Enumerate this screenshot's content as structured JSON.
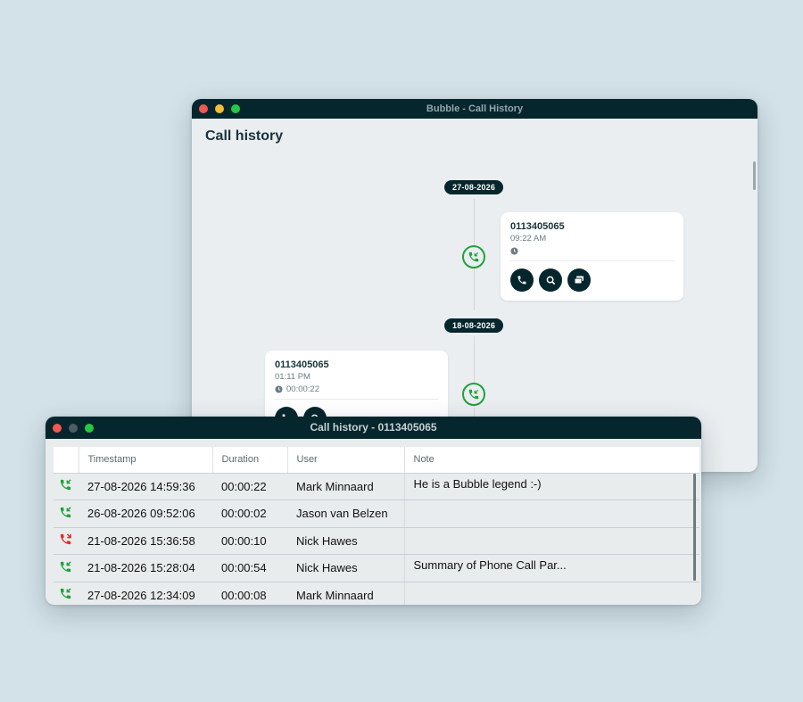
{
  "back_window": {
    "title": "Bubble - Call History",
    "page_title": "Call history",
    "entries": [
      {
        "date": "27-08-2026",
        "number": "0113405065",
        "time": "09:22 AM",
        "duration": "",
        "actions": [
          "phone-icon",
          "search-icon",
          "message-icon"
        ],
        "call_type_icon": "incoming-call-icon"
      },
      {
        "date": "18-08-2026",
        "number": "0113405065",
        "time": "01:11 PM",
        "duration": "00:00:22",
        "actions": [
          "phone-icon",
          "search-icon"
        ],
        "call_type_icon": "incoming-call-icon"
      }
    ]
  },
  "front_window": {
    "title": "Call history - 0113405065",
    "columns": [
      "Timestamp",
      "Duration",
      "User",
      "Note"
    ],
    "rows": [
      {
        "status": "incoming",
        "timestamp": "27-08-2026 14:59:36",
        "duration": "00:00:22",
        "user": "Mark Minnaard",
        "note": "He is a Bubble legend :-)"
      },
      {
        "status": "incoming",
        "timestamp": "26-08-2026 09:52:06",
        "duration": "00:00:02",
        "user": "Jason van Belzen",
        "note": ""
      },
      {
        "status": "missed",
        "timestamp": "21-08-2026 15:36:58",
        "duration": "00:00:10",
        "user": "Nick Hawes",
        "note": ""
      },
      {
        "status": "incoming",
        "timestamp": "21-08-2026 15:28:04",
        "duration": "00:00:54",
        "user": "Nick Hawes",
        "note": "Summary of Phone Call Par..."
      },
      {
        "status": "incoming",
        "timestamp": "27-08-2026 12:34:09",
        "duration": "00:00:08",
        "user": "Mark Minnaard",
        "note": ""
      }
    ]
  },
  "colors": {
    "dark_teal": "#06262d",
    "incoming_green": "#22a03a",
    "missed_red": "#e02b2b",
    "background": "#d3e1e8"
  }
}
